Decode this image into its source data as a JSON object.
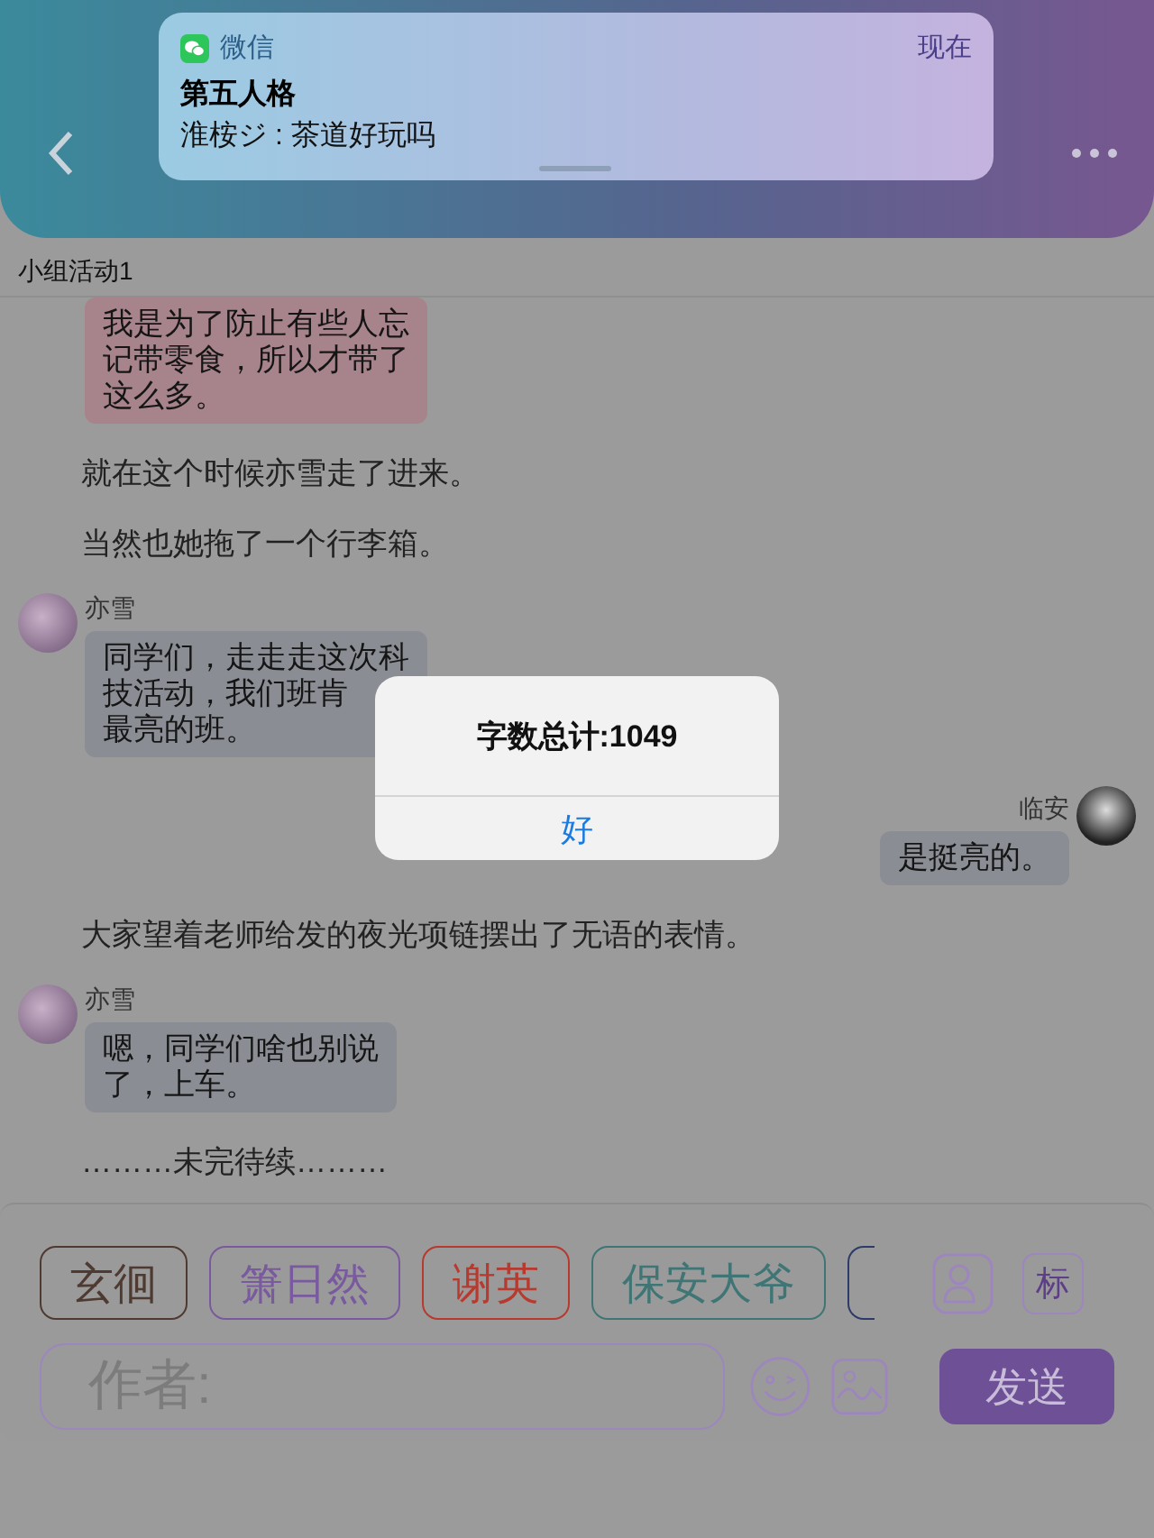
{
  "notification": {
    "app": "微信",
    "time": "现在",
    "title": "第五人格",
    "message": "淮桉ジ : 茶道好玩吗"
  },
  "group_title": "小组活动1",
  "messages": [
    {
      "kind": "left",
      "lines": [
        "我是为了防止有些人忘",
        "记带零食，所以才带了",
        "这么多。"
      ],
      "color": "#a7838b"
    },
    {
      "kind": "narration",
      "lines": [
        "就在这个时候亦雪走了进来。"
      ]
    },
    {
      "kind": "narration",
      "lines": [
        "当然也她拖了一个行李箱。"
      ]
    },
    {
      "kind": "left",
      "name": "亦雪",
      "lines": [
        "同学们，走走走这次科",
        "技活动，我们班肯",
        "最亮的班。"
      ],
      "color": "#8a8d93"
    },
    {
      "kind": "right",
      "name": "临安",
      "lines": [
        "是挺亮的。"
      ],
      "color": "#8a8d93"
    },
    {
      "kind": "narration",
      "lines": [
        "大家望着老师给发的夜光项链摆出了无语的表情。"
      ]
    },
    {
      "kind": "left",
      "name": "亦雪",
      "lines": [
        "嗯，同学们啥也别说",
        "了，上车。"
      ],
      "color": "#8a8d93"
    },
    {
      "kind": "narration",
      "lines": [
        "………未完待续………"
      ]
    }
  ],
  "characters": [
    {
      "label": "玄徊",
      "color": "#4e3a30"
    },
    {
      "label": "箫日然",
      "color": "#7a5a9e"
    },
    {
      "label": "谢英",
      "color": "#b8392e"
    },
    {
      "label": "保安大爷",
      "color": "#3f7675"
    }
  ],
  "tag_button": "标",
  "author_field": {
    "placeholder": "作者:"
  },
  "send_button": "发送",
  "alert": {
    "message": "字数总计:1049",
    "button": "好"
  }
}
